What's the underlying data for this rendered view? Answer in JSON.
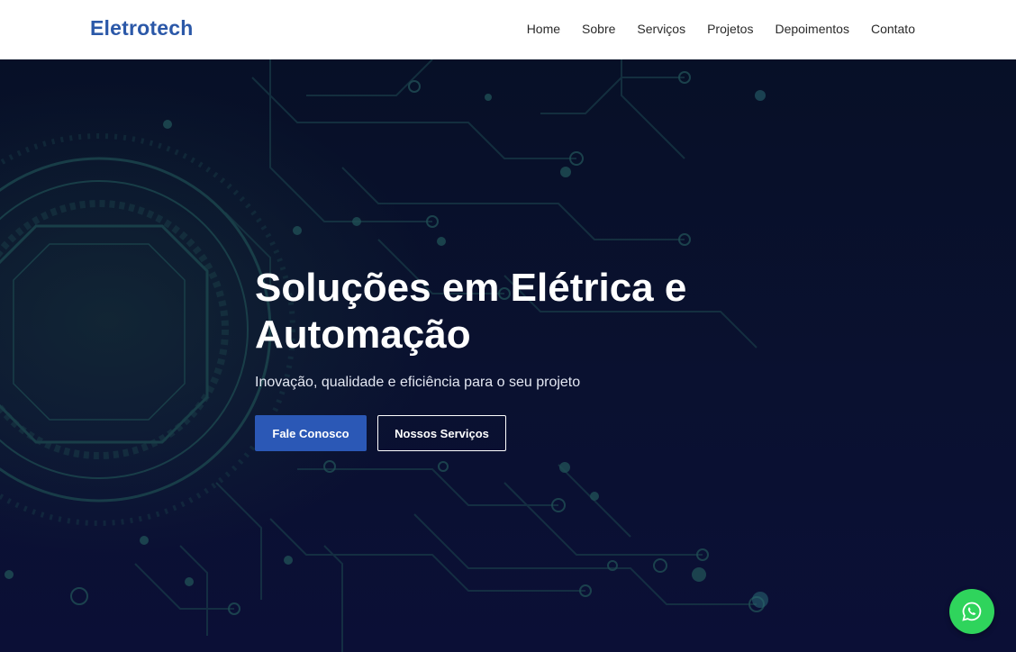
{
  "navbar": {
    "brand": "Eletrotech",
    "links": [
      "Home",
      "Sobre",
      "Serviços",
      "Projetos",
      "Depoimentos",
      "Contato"
    ]
  },
  "hero": {
    "title": "Soluções em Elétrica e Automação",
    "subtitle": "Inovação, qualidade e eficiência para o seu projeto",
    "primary_button": "Fale Conosco",
    "secondary_button": "Nossos Serviços",
    "background_icon": "circuit-board-pattern"
  },
  "floating": {
    "icon": "whatsapp-icon"
  },
  "colors": {
    "brand": "#2b58a8",
    "primary_button": "#2b58b6",
    "whatsapp": "#2fd45c",
    "hero_background": "#0a1130",
    "circuit_lines": "#1f4a52"
  }
}
